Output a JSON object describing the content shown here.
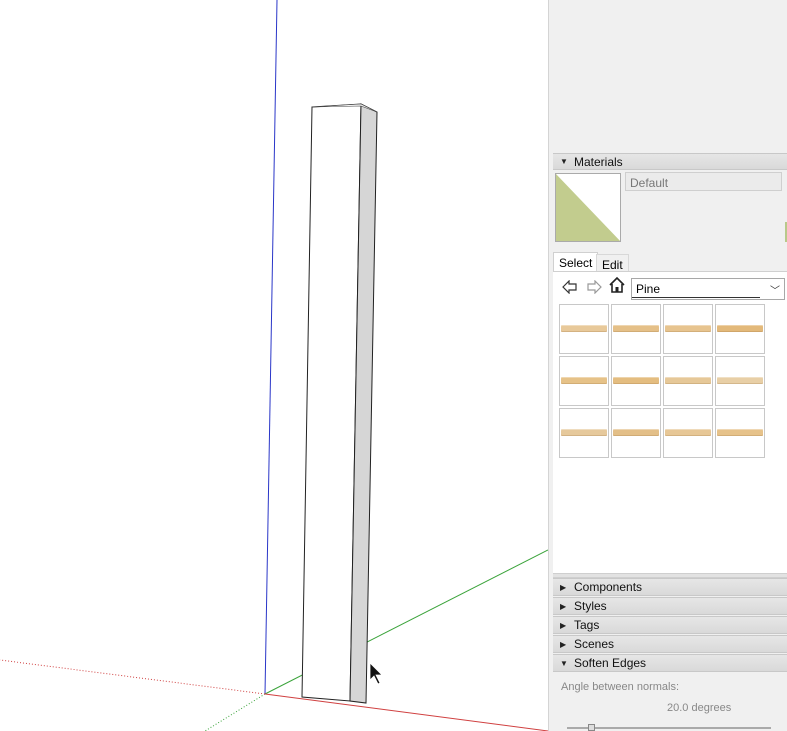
{
  "viewport": {
    "axis_colors": {
      "blue": "#2a36c8",
      "green": "#3aa33a",
      "red": "#d04040"
    }
  },
  "tray": {
    "materials": {
      "header": "Materials",
      "material_name": "Default",
      "preview_color": "#c2cc8e",
      "tabs": [
        {
          "label": "Select"
        },
        {
          "label": "Edit"
        }
      ],
      "nav_icons": [
        "back-arrow-icon",
        "forward-arrow-icon",
        "home-icon"
      ],
      "collection": "Pine",
      "swatches": [
        "#e8c99a",
        "#e5c088",
        "#e7c48f",
        "#e3b97a",
        "#e6c288",
        "#e4bd80",
        "#e6c898",
        "#e8cfa6",
        "#e6c99c",
        "#e3bf88",
        "#e7c796",
        "#e6c28a"
      ]
    },
    "panels": [
      {
        "label": "Components",
        "expanded": false
      },
      {
        "label": "Styles",
        "expanded": false
      },
      {
        "label": "Tags",
        "expanded": false
      },
      {
        "label": "Scenes",
        "expanded": false
      },
      {
        "label": "Soften Edges",
        "expanded": true
      }
    ],
    "soften_edges": {
      "angle_label": "Angle between normals:",
      "angle_value": "20.0  degrees"
    }
  }
}
